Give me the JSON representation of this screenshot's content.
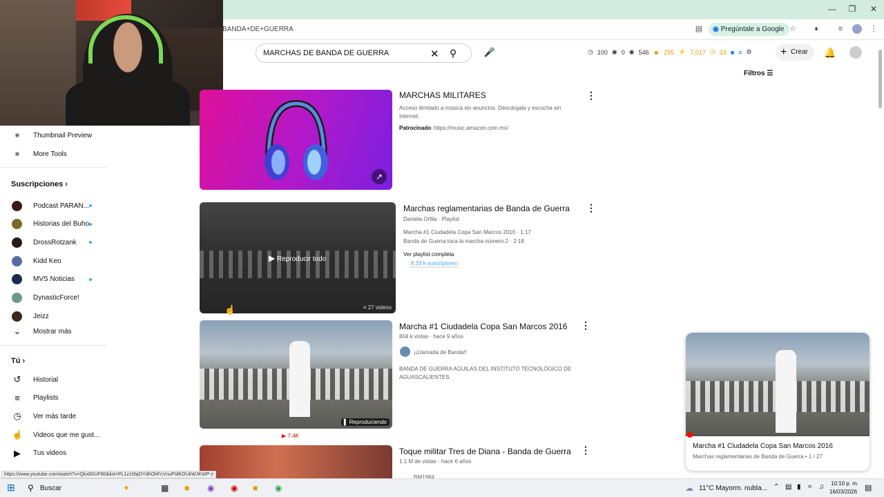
{
  "browser": {
    "url_fragment": "BANDA+DE+GUERRA",
    "gemini_label": "Pregúntale a Google",
    "status_url": "https://www.youtube.com/watch?v=Qkx8SUF80&list=PL1z1t9qOYdhOhFcVnuPIdKOUkWJKWP-z"
  },
  "search": {
    "query": "MARCHAS DE BANDA DE GUERRA"
  },
  "extensions": {
    "stats": [
      "100",
      "0",
      "546",
      "295",
      "7,017",
      "24"
    ]
  },
  "header": {
    "create_label": "Crear",
    "filters_label": "Filtros"
  },
  "sidebar": {
    "tools": [
      {
        "label": "Thumbnail Preview"
      },
      {
        "label": "More Tools"
      }
    ],
    "subs_heading": "Suscripciones",
    "subscriptions": [
      {
        "label": "Podcast PARAN...",
        "color": "#3a1a1a",
        "dot": true
      },
      {
        "label": "Historias del Buho",
        "color": "#7a6a2a",
        "dot": true
      },
      {
        "label": "DrossRotzank",
        "color": "#2a1a1a",
        "dot": true
      },
      {
        "label": "Kidd Keo",
        "color": "#5a6aa0",
        "dot": false
      },
      {
        "label": "MVS Noticias",
        "color": "#1a2a4a",
        "dot": true
      },
      {
        "label": "DynasticForce!",
        "color": "#6a9a8a",
        "dot": false
      },
      {
        "label": "Jeizz",
        "color": "#3a2a1a",
        "dot": false
      }
    ],
    "show_more": "Mostrar más",
    "you_heading": "Tú",
    "you_items": [
      {
        "label": "Historial",
        "icon": "history-icon"
      },
      {
        "label": "Playlists",
        "icon": "playlists-icon"
      },
      {
        "label": "Ver más tarde",
        "icon": "watch-later-icon"
      },
      {
        "label": "Videos que me gust...",
        "icon": "liked-icon"
      },
      {
        "label": "Tus videos",
        "icon": "your-videos-icon"
      }
    ]
  },
  "results": {
    "ad": {
      "title": "MARCHAS MILITARES",
      "desc1": "Acceso ilimitado a música sin anuncios. Descárgala y escucha sin",
      "desc2": "Internet.",
      "sponsored": "Patrocinado",
      "link": "· https://music.amazon.com.mx/"
    },
    "playlist": {
      "title": "Marchas reglamentarias de Banda de Guerra",
      "channel": "Daniela Orfila · Playlist",
      "item1": "Marcha #1 Ciudadela Copa San Marcos 2016 · 1:17",
      "item2": "Banda de Guerra toca la marcha número 2 · 2:18",
      "view_full": "Ver playlist completa",
      "subs": "8.33 k suscriptores",
      "play_all": "Reproducir todo",
      "count": "27 videos"
    },
    "video1": {
      "title": "Marcha #1 Ciudadela Copa San Marcos 2016",
      "meta": "804 k vistas · hace 9 años",
      "channel": "¡¡Llamada de Banda!!",
      "desc1": "BANDA DE GUERRA AGUILAS DEL INSTITUTO TECNOLÓGICO DE",
      "desc2": "AGUASCALIENTES.",
      "badge": "Reproduciendo",
      "yt_count": "7.4K"
    },
    "video2": {
      "title": "Toque militar Tres de Diana - Banda de Guerra",
      "meta": "1.1 M de vistas · hace 6 años",
      "channel": "BM1984"
    }
  },
  "miniplayer": {
    "title": "Marcha #1 Ciudadela Copa San Marcos 2016",
    "subtitle": "Marchas reglamentarias de Banda de Guerra • 1 / 27"
  },
  "taskbar": {
    "search": "Buscar",
    "weather": "11°C  Mayorm. nubla...",
    "time": "10:10 p. m.",
    "date": "16/03/2026"
  },
  "colors": {
    "accent": "#3ea6ff",
    "yt_red": "#ff0000",
    "ad_pink": "#e0109a",
    "ad_purple": "#7a20e0"
  }
}
